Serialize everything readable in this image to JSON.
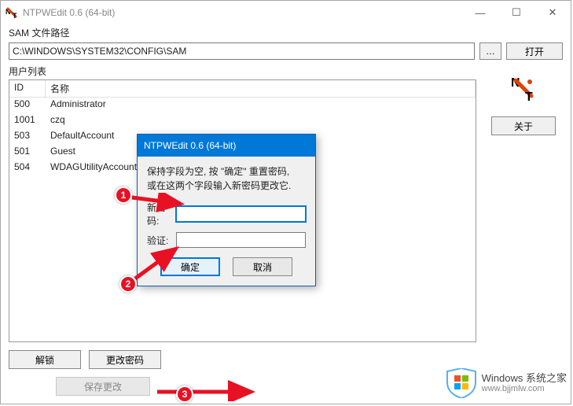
{
  "window": {
    "title": "NTPWEdit 0.6 (64-bit)",
    "minimize": "—",
    "maximize": "☐",
    "close": "✕"
  },
  "path": {
    "label": "SAM 文件路径",
    "value": "C:\\WINDOWS\\SYSTEM32\\CONFIG\\SAM",
    "browse": "…",
    "open": "打开"
  },
  "userlist": {
    "label": "用户列表",
    "col_id": "ID",
    "col_name": "名称",
    "rows": [
      {
        "id": "500",
        "name": "Administrator"
      },
      {
        "id": "1001",
        "name": "czq"
      },
      {
        "id": "503",
        "name": "DefaultAccount"
      },
      {
        "id": "501",
        "name": "Guest"
      },
      {
        "id": "504",
        "name": "WDAGUtilityAccount"
      }
    ]
  },
  "buttons": {
    "unlock": "解锁",
    "change_pw": "更改密码",
    "save": "保存更改",
    "about": "关于"
  },
  "dialog": {
    "title": "NTPWEdit 0.6 (64-bit)",
    "instruction1": "保持字段为空, 按 \"确定\" 重置密码,",
    "instruction2": "或在这两个字段输入新密码更改它.",
    "lbl_newpw": "新密码:",
    "lbl_verify": "验证:",
    "ok": "确定",
    "cancel": "取消",
    "newpw_value": "",
    "verify_value": ""
  },
  "callouts": {
    "c1": "1",
    "c2": "2",
    "c3": "3"
  },
  "watermark": {
    "line1": "Windows 系统之家",
    "line2": "www.bjjmlw.com"
  }
}
